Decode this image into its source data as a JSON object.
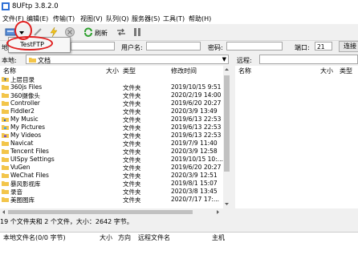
{
  "window": {
    "title": "8UFtp 3.8.2.0"
  },
  "menu": [
    "文件(F)",
    "编辑(E)",
    "传输(T)",
    "视图(V)",
    "队列(Q)",
    "服务器(S)",
    "工具(T)",
    "帮助(H)"
  ],
  "toolbar": {
    "refresh_label": "刷新"
  },
  "popup": {
    "item": "TestFTP"
  },
  "connection": {
    "host_label": "地址:",
    "user_label": "用户名:",
    "password_label": "密码:",
    "port_label": "端口:",
    "port_value": "21",
    "connect_label": "连接"
  },
  "local": {
    "path_label": "本地:",
    "path_value": "文档",
    "columns": {
      "name": "名称",
      "size": "大小",
      "type": "类型",
      "date": "修改时间"
    },
    "rows": [
      {
        "name": "上层目录",
        "type": "",
        "date": "",
        "icon": "up-folder"
      },
      {
        "name": "360js Files",
        "type": "文件夹",
        "date": "2019/10/15 9:51",
        "icon": "folder"
      },
      {
        "name": "360摄像头",
        "type": "文件夹",
        "date": "2020/2/19 14:00",
        "icon": "folder"
      },
      {
        "name": "Controller",
        "type": "文件夹",
        "date": "2019/6/20 20:27",
        "icon": "folder"
      },
      {
        "name": "Fiddler2",
        "type": "文件夹",
        "date": "2020/3/9 13:49",
        "icon": "folder"
      },
      {
        "name": "My Music",
        "type": "文件夹",
        "date": "2019/6/13 22:53",
        "icon": "music-folder"
      },
      {
        "name": "My Pictures",
        "type": "文件夹",
        "date": "2019/6/13 22:53",
        "icon": "pictures-folder"
      },
      {
        "name": "My Videos",
        "type": "文件夹",
        "date": "2019/6/13 22:53",
        "icon": "videos-folder"
      },
      {
        "name": "Navicat",
        "type": "文件夹",
        "date": "2019/7/9 11:40",
        "icon": "folder"
      },
      {
        "name": "Tencent Files",
        "type": "文件夹",
        "date": "2020/3/9 12:58",
        "icon": "folder"
      },
      {
        "name": "UISpy Settings",
        "type": "文件夹",
        "date": "2019/10/15 10:...",
        "icon": "folder"
      },
      {
        "name": "VuGen",
        "type": "文件夹",
        "date": "2019/6/20 20:27",
        "icon": "folder"
      },
      {
        "name": "WeChat Files",
        "type": "文件夹",
        "date": "2020/3/9 12:51",
        "icon": "folder"
      },
      {
        "name": "暴风影视库",
        "type": "文件夹",
        "date": "2019/8/1 15:07",
        "icon": "folder"
      },
      {
        "name": "录音",
        "type": "文件夹",
        "date": "2020/3/8 13:45",
        "icon": "folder"
      },
      {
        "name": "美图图库",
        "type": "文件夹",
        "date": "2020/7/17 17:...",
        "icon": "folder"
      }
    ],
    "status": "19 个文件夹和 2 个文件，大小：2642 字节。"
  },
  "remote": {
    "path_label": "远程:",
    "columns": {
      "name": "名称",
      "size": "大小",
      "type": "类型"
    }
  },
  "queue": {
    "columns": {
      "local": "本地文件名(0/0 字节)",
      "size": "大小",
      "direction": "方向",
      "remote": "远程文件名",
      "host": "主机"
    }
  },
  "colors": {
    "folder": "#f3c54a",
    "accent": "#1f5fbf",
    "highlight": "#e02020"
  }
}
